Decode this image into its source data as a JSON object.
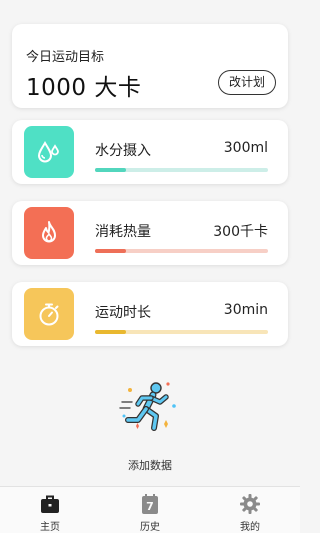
{
  "goal": {
    "label": "今日运动目标",
    "value": "1000 大卡",
    "change_button": "改计划"
  },
  "metrics": [
    {
      "title": "水分摄入",
      "value": "300ml",
      "icon": "water-drop-icon",
      "color": "#4fe0c5",
      "track_color": "#cdeee8",
      "fill_color": "#52d6bd",
      "progress": 0.18
    },
    {
      "title": "消耗热量",
      "value": "300千卡",
      "icon": "flame-icon",
      "color": "#f36f55",
      "track_color": "#f7cfc6",
      "fill_color": "#ee6f58",
      "progress": 0.18
    },
    {
      "title": "运动时长",
      "value": "30min",
      "icon": "stopwatch-icon",
      "color": "#f6c65a",
      "track_color": "#f8e5b8",
      "fill_color": "#e9b82f",
      "progress": 0.18
    }
  ],
  "add": {
    "label": "添加数据",
    "icon": "running-person-icon"
  },
  "tabs": [
    {
      "label": "主页",
      "icon": "home-briefcase-icon",
      "active": true
    },
    {
      "label": "历史",
      "icon": "calendar-icon",
      "active": false
    },
    {
      "label": "我的",
      "icon": "gear-icon",
      "active": false
    }
  ]
}
